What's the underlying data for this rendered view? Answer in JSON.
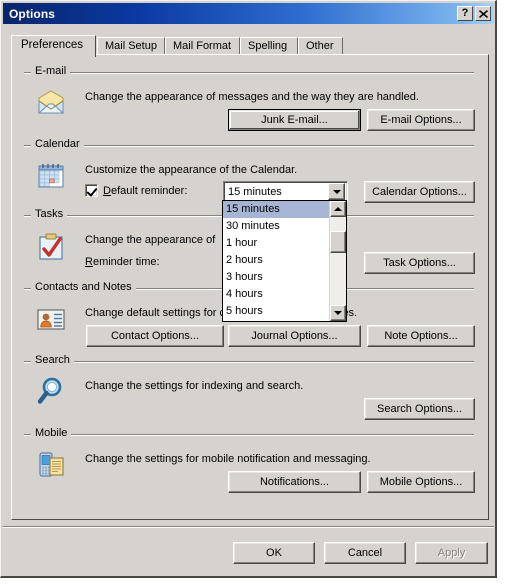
{
  "window": {
    "title": "Options",
    "help_button": "?",
    "close_button": "✕"
  },
  "tabs": [
    {
      "label": "Preferences",
      "active": true
    },
    {
      "label": "Mail Setup",
      "active": false
    },
    {
      "label": "Mail Format",
      "active": false
    },
    {
      "label": "Spelling",
      "active": false
    },
    {
      "label": "Other",
      "active": false
    }
  ],
  "groups": {
    "email": {
      "label": "E-mail",
      "description": "Change the appearance of messages and the way they are handled.",
      "icon": "envelope-icon",
      "buttons": {
        "junk": "Junk E-mail...",
        "options": "E-mail Options..."
      }
    },
    "calendar": {
      "label": "Calendar",
      "description": "Customize the appearance of the Calendar.",
      "icon": "calendar-icon",
      "checkbox_label": "Default reminder:",
      "checkbox_checked": true,
      "combo_value": "15 minutes",
      "buttons": {
        "options": "Calendar Options..."
      }
    },
    "tasks": {
      "label": "Tasks",
      "description": "Change the appearance of",
      "icon": "clipboard-check-icon",
      "reminder_label": "Reminder time:",
      "buttons": {
        "options": "Task Options..."
      }
    },
    "contacts": {
      "label": "Contacts and Notes",
      "description": "Change default settings for contacts, journal, and notes.",
      "icon": "contact-card-icon",
      "buttons": {
        "contact": "Contact Options...",
        "journal": "Journal Options...",
        "note": "Note Options..."
      }
    },
    "search": {
      "label": "Search",
      "description": "Change the settings for indexing and search.",
      "icon": "magnifier-icon",
      "buttons": {
        "options": "Search Options..."
      }
    },
    "mobile": {
      "label": "Mobile",
      "description": "Change the settings for mobile notification and messaging.",
      "icon": "mobile-phone-icon",
      "buttons": {
        "notifications": "Notifications...",
        "options": "Mobile Options..."
      }
    }
  },
  "dropdown": {
    "open": true,
    "selected_index": 0,
    "items": [
      "15 minutes",
      "30 minutes",
      "1 hour",
      "2 hours",
      "3 hours",
      "4 hours",
      "5 hours"
    ],
    "scroll_up_arrow": "▲",
    "scroll_down_arrow": "▼"
  },
  "footer": {
    "ok": "OK",
    "cancel": "Cancel",
    "apply": "Apply",
    "apply_disabled": true
  },
  "colors": {
    "dialog_face": "#d6d3ce",
    "title_gradient_start": "#09246c",
    "title_gradient_end": "#a9d2f7",
    "selection": "#a6b5d4",
    "group_line": "#848278",
    "disabled_text": "#848278"
  }
}
